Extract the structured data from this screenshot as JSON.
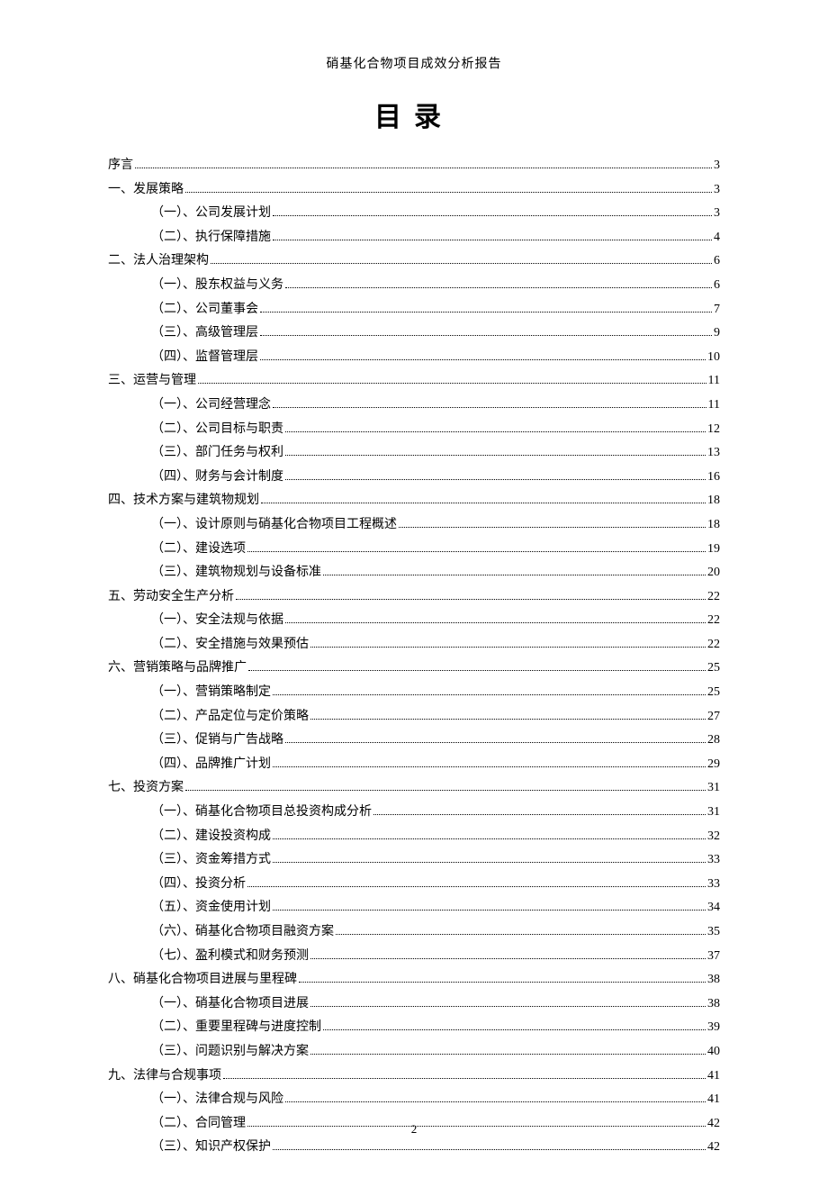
{
  "header": "硝基化合物项目成效分析报告",
  "title": "目录",
  "page_number": "2",
  "toc": [
    {
      "level": 1,
      "label": "序言",
      "page": "3"
    },
    {
      "level": 1,
      "label": "一、发展策略",
      "page": "3"
    },
    {
      "level": 2,
      "label": "（一）、公司发展计划",
      "page": "3"
    },
    {
      "level": 2,
      "label": "（二）、执行保障措施",
      "page": "4"
    },
    {
      "level": 1,
      "label": "二、法人治理架构",
      "page": "6"
    },
    {
      "level": 2,
      "label": "（一）、股东权益与义务",
      "page": "6"
    },
    {
      "level": 2,
      "label": "（二）、公司董事会",
      "page": "7"
    },
    {
      "level": 2,
      "label": "（三）、高级管理层",
      "page": "9"
    },
    {
      "level": 2,
      "label": "（四）、监督管理层",
      "page": "10"
    },
    {
      "level": 1,
      "label": "三、运营与管理",
      "page": "11"
    },
    {
      "level": 2,
      "label": "（一）、公司经营理念",
      "page": "11"
    },
    {
      "level": 2,
      "label": "（二）、公司目标与职责",
      "page": "12"
    },
    {
      "level": 2,
      "label": "（三）、部门任务与权利",
      "page": "13"
    },
    {
      "level": 2,
      "label": "（四）、财务与会计制度",
      "page": "16"
    },
    {
      "level": 1,
      "label": "四、技术方案与建筑物规划",
      "page": "18"
    },
    {
      "level": 2,
      "label": "（一）、设计原则与硝基化合物项目工程概述",
      "page": "18"
    },
    {
      "level": 2,
      "label": "（二）、建设选项",
      "page": "19"
    },
    {
      "level": 2,
      "label": "（三）、建筑物规划与设备标准",
      "page": "20"
    },
    {
      "level": 1,
      "label": "五、劳动安全生产分析",
      "page": "22"
    },
    {
      "level": 2,
      "label": "（一）、安全法规与依据",
      "page": "22"
    },
    {
      "level": 2,
      "label": "（二）、安全措施与效果预估",
      "page": "22"
    },
    {
      "level": 1,
      "label": "六、营销策略与品牌推广",
      "page": "25"
    },
    {
      "level": 2,
      "label": "（一）、营销策略制定",
      "page": "25"
    },
    {
      "level": 2,
      "label": "（二）、产品定位与定价策略",
      "page": "27"
    },
    {
      "level": 2,
      "label": "（三）、促销与广告战略",
      "page": "28"
    },
    {
      "level": 2,
      "label": "（四）、品牌推广计划",
      "page": "29"
    },
    {
      "level": 1,
      "label": "七、投资方案",
      "page": "31"
    },
    {
      "level": 2,
      "label": "（一）、硝基化合物项目总投资构成分析",
      "page": "31"
    },
    {
      "level": 2,
      "label": "（二）、建设投资构成",
      "page": "32"
    },
    {
      "level": 2,
      "label": "（三）、资金筹措方式",
      "page": "33"
    },
    {
      "level": 2,
      "label": "（四）、投资分析",
      "page": "33"
    },
    {
      "level": 2,
      "label": "（五）、资金使用计划",
      "page": "34"
    },
    {
      "level": 2,
      "label": "（六）、硝基化合物项目融资方案",
      "page": "35"
    },
    {
      "level": 2,
      "label": "（七）、盈利模式和财务预测",
      "page": "37"
    },
    {
      "level": 1,
      "label": "八、硝基化合物项目进展与里程碑",
      "page": "38"
    },
    {
      "level": 2,
      "label": "（一）、硝基化合物项目进展",
      "page": "38"
    },
    {
      "level": 2,
      "label": "（二）、重要里程碑与进度控制",
      "page": "39"
    },
    {
      "level": 2,
      "label": "（三）、问题识别与解决方案",
      "page": "40"
    },
    {
      "level": 1,
      "label": "九、法律与合规事项",
      "page": "41"
    },
    {
      "level": 2,
      "label": "（一）、法律合规与风险",
      "page": "41"
    },
    {
      "level": 2,
      "label": "（二）、合同管理",
      "page": "42"
    },
    {
      "level": 2,
      "label": "（三）、知识产权保护",
      "page": "42"
    }
  ]
}
